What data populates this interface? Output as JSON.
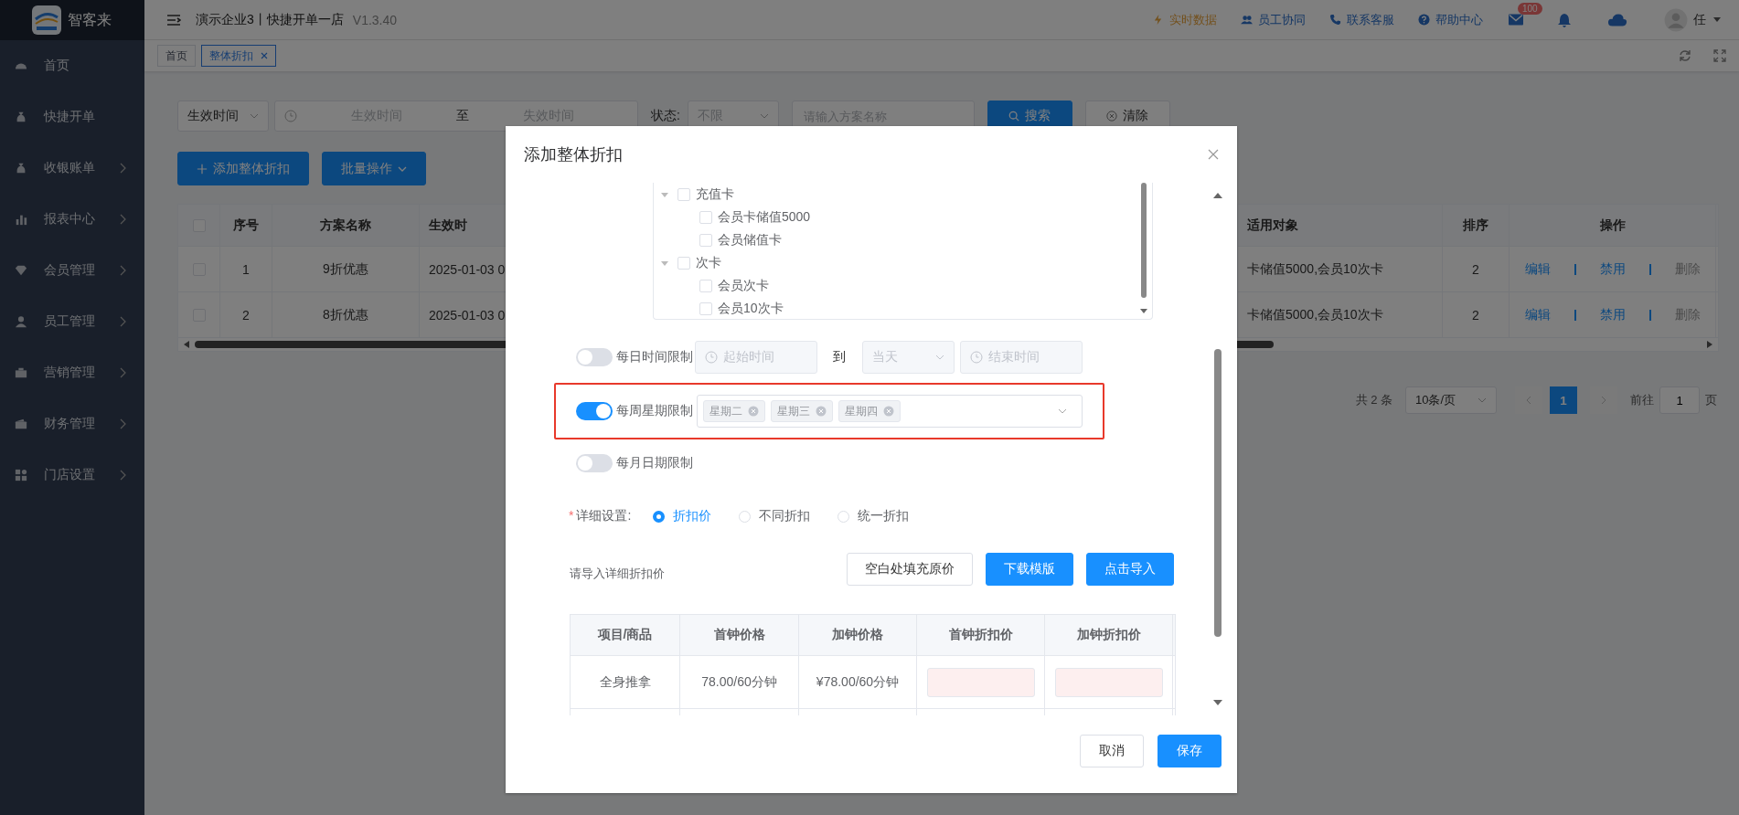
{
  "app": {
    "logo_text": "智客来"
  },
  "header": {
    "title": "演示企业3丨快捷开单一店",
    "version": "V1.3.40",
    "links": [
      {
        "label": "实时数据",
        "kind": "realtime"
      },
      {
        "label": "员工协同",
        "kind": "team"
      },
      {
        "label": "联系客服",
        "kind": "phone"
      },
      {
        "label": "帮助中心",
        "kind": "help"
      }
    ],
    "mail_badge": "100",
    "user": "任"
  },
  "page_tabs": [
    {
      "label": "首页",
      "selected": false,
      "closable": false
    },
    {
      "label": "整体折扣",
      "selected": true,
      "closable": true
    }
  ],
  "sidebar": {
    "items": [
      {
        "label": "首页",
        "kind": "dashboard",
        "has_arrow": false
      },
      {
        "label": "快捷开单",
        "kind": "moneybag",
        "has_arrow": false
      },
      {
        "label": "收银账单",
        "kind": "moneybag",
        "has_arrow": true
      },
      {
        "label": "报表中心",
        "kind": "chart",
        "has_arrow": true
      },
      {
        "label": "会员管理",
        "kind": "diamond",
        "has_arrow": true
      },
      {
        "label": "员工管理",
        "kind": "person",
        "has_arrow": true
      },
      {
        "label": "营销管理",
        "kind": "briefcase",
        "has_arrow": true
      },
      {
        "label": "财务管理",
        "kind": "wallet",
        "has_arrow": true
      },
      {
        "label": "门店设置",
        "kind": "grid",
        "has_arrow": true
      }
    ]
  },
  "filters": {
    "date_type": "生效时间",
    "start_placeholder": "生效时间",
    "range_separator": "至",
    "end_placeholder": "失效时间",
    "status_label": "状态:",
    "status_value": "不限",
    "name_placeholder": "请输入方案名称",
    "search_button": "搜索",
    "clear_button": "清除"
  },
  "actions": {
    "add_button": "添加整体折扣",
    "batch_button": "批量操作"
  },
  "table": {
    "select_all_checked": false,
    "columns": [
      "序号",
      "方案名称",
      "生效时",
      "适用对象",
      "排序",
      "操作"
    ],
    "rows": [
      {
        "checked": false,
        "cells": [
          "1",
          "9折优惠",
          "2025-01-03 0",
          "卡储值5000,会员10次卡",
          "2"
        ],
        "actions": [
          {
            "label": "编辑",
            "kind": "link"
          },
          {
            "label": "禁用",
            "kind": "link"
          },
          {
            "label": "删除",
            "kind": "muted"
          }
        ]
      },
      {
        "checked": false,
        "cells": [
          "2",
          "8折优惠",
          "2025-01-03 0",
          "卡储值5000,会员10次卡",
          "2"
        ],
        "actions": [
          {
            "label": "编辑",
            "kind": "link"
          },
          {
            "label": "禁用",
            "kind": "link"
          },
          {
            "label": "删除",
            "kind": "muted"
          }
        ]
      }
    ]
  },
  "pagination": {
    "total": "共 2 条",
    "page_size": "10条/页",
    "pages": [
      {
        "label": "1",
        "selected": true
      }
    ],
    "goto_label": "前往",
    "goto_value": "1",
    "goto_suffix": "页"
  },
  "dialog": {
    "title": "添加整体折扣",
    "tree": [
      {
        "label": "充值卡",
        "checked": false,
        "expanded": true,
        "children": [
          {
            "label": "会员卡储值5000",
            "checked": false
          },
          {
            "label": "会员储值卡",
            "checked": false
          }
        ]
      },
      {
        "label": "次卡",
        "checked": false,
        "expanded": true,
        "children": [
          {
            "label": "会员次卡",
            "checked": false
          },
          {
            "label": "会员10次卡",
            "checked": false
          }
        ]
      }
    ],
    "limits": [
      {
        "kind": "time",
        "label": "每日时间限制",
        "on": false,
        "highlighted": false,
        "start_placeholder": "起始时间",
        "separator": "到",
        "day_value": "当天",
        "end_placeholder": "结束时间"
      },
      {
        "kind": "weekday",
        "label": "每周星期限制",
        "on": true,
        "highlighted": true,
        "tags": [
          "星期二",
          "星期三",
          "星期四"
        ]
      },
      {
        "kind": "plain",
        "label": "每月日期限制",
        "on": false,
        "highlighted": false
      }
    ],
    "detail": {
      "label": "详细设置:",
      "required_mark": "*",
      "options": [
        {
          "label": "折扣价",
          "selected": true
        },
        {
          "label": "不同折扣",
          "selected": false
        },
        {
          "label": "统一折扣",
          "selected": false
        }
      ]
    },
    "import": {
      "label": "请导入详细折扣价",
      "buttons": [
        {
          "label": "空白处填充原价",
          "kind": "plain"
        },
        {
          "label": "下载模版",
          "kind": "primary"
        },
        {
          "label": "点击导入",
          "kind": "primary"
        }
      ]
    },
    "price_table": {
      "columns": [
        {
          "label": "项目/商品",
          "kind": "text"
        },
        {
          "label": "首钟价格",
          "kind": "text"
        },
        {
          "label": "加钟价格",
          "kind": "text"
        },
        {
          "label": "首钟折扣价",
          "kind": "input"
        },
        {
          "label": "加钟折扣价",
          "kind": "input"
        }
      ],
      "rows": [
        {
          "cells": [
            "全身推拿",
            "78.00/60分钟",
            "¥78.00/60分钟"
          ]
        }
      ]
    },
    "footer_buttons": [
      {
        "label": "取消",
        "kind": "plain"
      },
      {
        "label": "保存",
        "kind": "primary"
      }
    ]
  }
}
